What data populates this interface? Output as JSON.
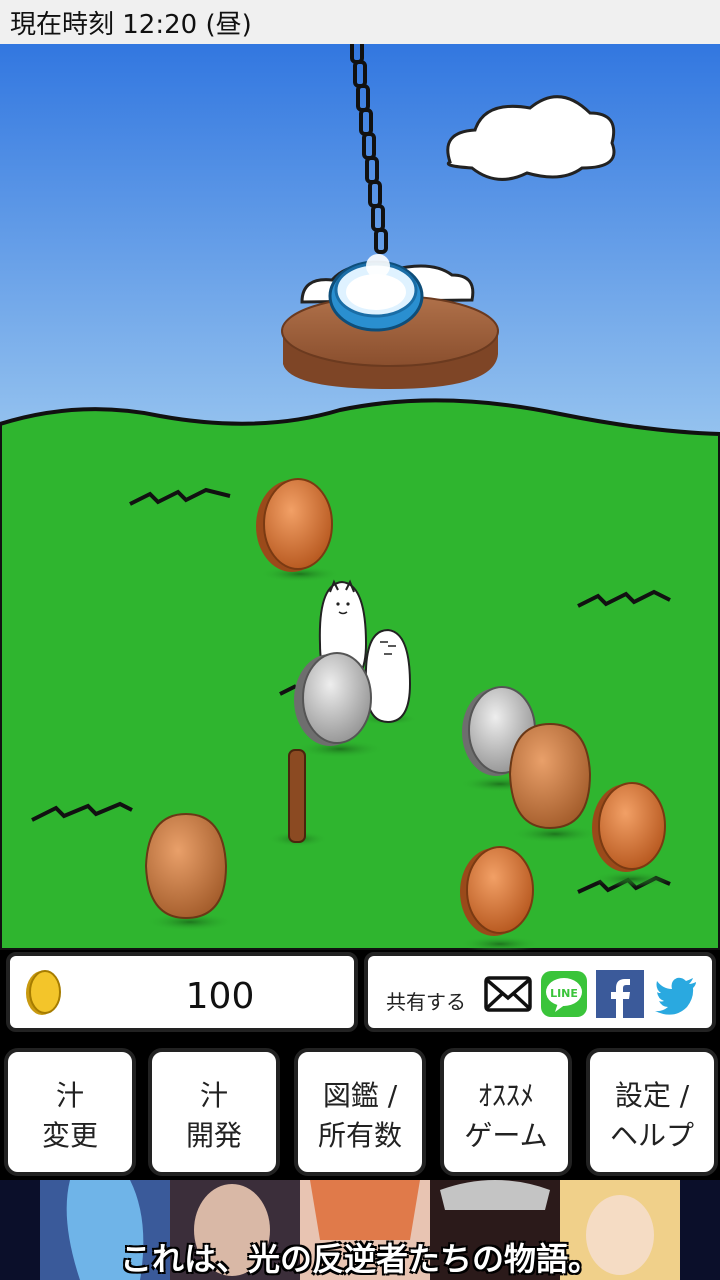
{
  "status": {
    "time_text": "現在時刻 12:20 (昼)"
  },
  "hud": {
    "coin_count": "100",
    "share_label": "共有する",
    "share_icons": [
      "mail-icon",
      "line-icon",
      "facebook-icon",
      "twitter-icon"
    ],
    "line_text": "LINE"
  },
  "menu": [
    {
      "line1": "汁",
      "line2": "変更"
    },
    {
      "line1": "汁",
      "line2": "開発"
    },
    {
      "line1": "図鑑 /",
      "line2": "所有数"
    },
    {
      "line1": "ｵｽｽﾒ",
      "line2": "ゲーム"
    },
    {
      "line1": "設定 /",
      "line2": "ヘルプ"
    }
  ],
  "ad": {
    "text": "これは、光の反逆者たちの物語。"
  },
  "colors": {
    "sky": "#3f7fe0",
    "grass": "#2fb52f",
    "copper": "#d0712e",
    "silver": "#b8b8b8"
  }
}
